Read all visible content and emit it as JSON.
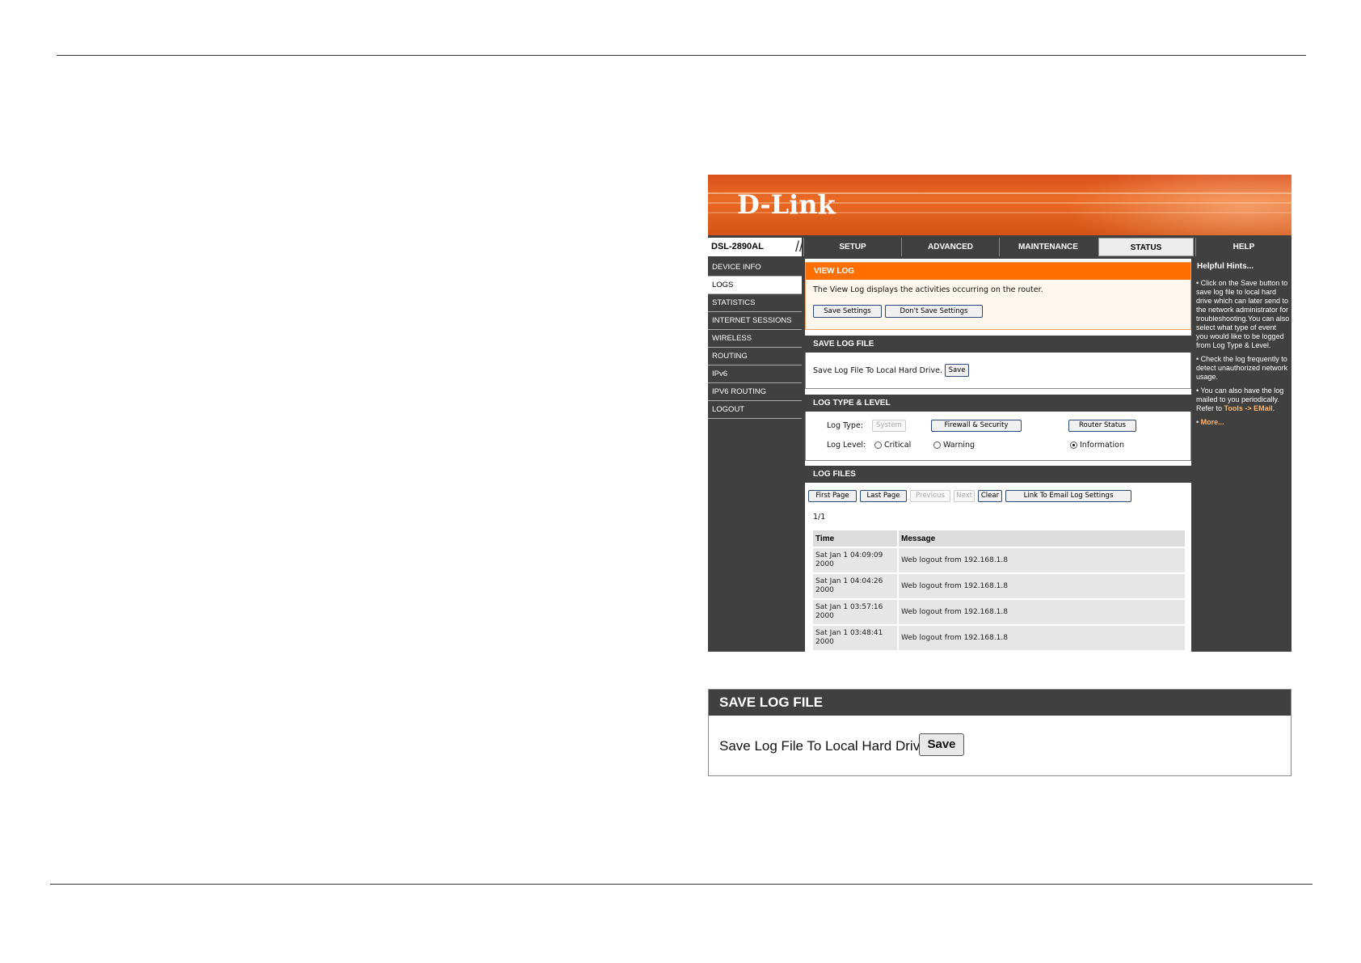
{
  "brand": {
    "logo_text": "D-Link",
    "model": "DSL-2890AL",
    "accent": "#ff6f00",
    "nav_bg": "#404040"
  },
  "top_tabs": [
    {
      "label": "SETUP"
    },
    {
      "label": "ADVANCED"
    },
    {
      "label": "MAINTENANCE"
    },
    {
      "label": "STATUS",
      "active": true
    },
    {
      "label": "HELP"
    }
  ],
  "sidebar": {
    "items": [
      {
        "label": "DEVICE INFO"
      },
      {
        "label": "LOGS",
        "active": true
      },
      {
        "label": "STATISTICS"
      },
      {
        "label": "INTERNET SESSIONS"
      },
      {
        "label": "WIRELESS"
      },
      {
        "label": "ROUTING"
      },
      {
        "label": "IPv6"
      },
      {
        "label": "IPV6 ROUTING"
      },
      {
        "label": "LOGOUT"
      }
    ]
  },
  "view_log": {
    "title": "VIEW LOG",
    "description": "The View Log displays the activities occurring on the router.",
    "save_settings": "Save Settings",
    "dont_save": "Don't Save Settings"
  },
  "save_log": {
    "title": "SAVE LOG FILE",
    "label": "Save Log File To Local Hard Drive.",
    "save_btn": "Save"
  },
  "log_type": {
    "title": "LOG TYPE & LEVEL",
    "type_label": "Log Type:",
    "types": [
      "System",
      "Firewall & Security",
      "Router Status"
    ],
    "level_label": "Log Level:",
    "levels": [
      "Critical",
      "Warning",
      "Information"
    ],
    "selected_level": "Information"
  },
  "log_files": {
    "title": "LOG FILES",
    "buttons": {
      "first": "First Page",
      "last": "Last Page",
      "previous": "Previous",
      "next": "Next",
      "clear": "Clear",
      "email": "Link To Email Log Settings"
    },
    "page": "1/1",
    "headers": {
      "time": "Time",
      "message": "Message"
    },
    "rows": [
      {
        "time": "Sat Jan 1 04:09:09 2000",
        "message": "Web logout from 192.168.1.8"
      },
      {
        "time": "Sat Jan 1 04:04:26 2000",
        "message": "Web logout from 192.168.1.8"
      },
      {
        "time": "Sat Jan 1 03:57:16 2000",
        "message": "Web logout from 192.168.1.8"
      },
      {
        "time": "Sat Jan 1 03:48:41 2000",
        "message": "Web logout from 192.168.1.8"
      }
    ]
  },
  "hints": {
    "title": "Helpful Hints...",
    "items": [
      "Click on the Save button to save log file to local hard drive which can later send to the network administrator for troubleshooting.You can also select what type of event you would like to be logged from Log Type & Level.",
      "Check the log frequently to detect unauthorized network usage.",
      "You can also have the log mailed to you periodically. Refer to"
    ],
    "link": "Tools -> EMail",
    "more": "More..."
  },
  "enlarged": {
    "title": "SAVE LOG FILE",
    "label": "Save Log File To Local Hard Drive.",
    "save_btn": "Save"
  }
}
